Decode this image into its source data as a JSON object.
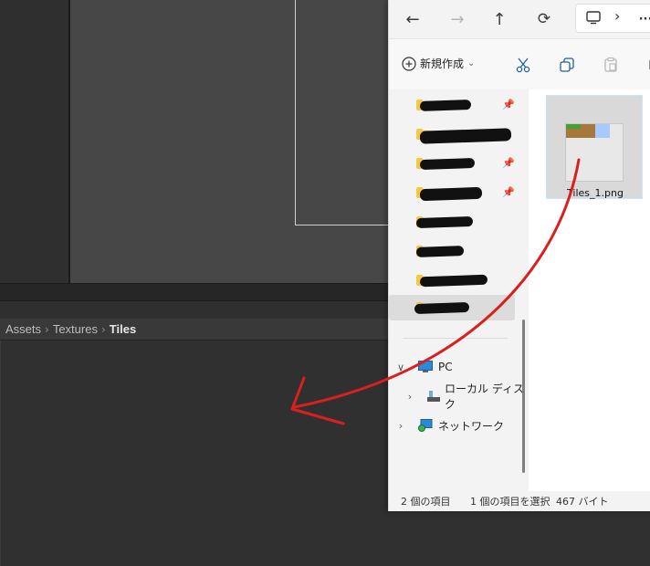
{
  "unity": {
    "breadcrumb": [
      "Assets",
      "Textures",
      "Tiles"
    ]
  },
  "explorer": {
    "nav": {
      "back_glyph": "←",
      "forward_glyph": "→",
      "up_glyph": "↑",
      "refresh_glyph": "⟳",
      "more_glyph": "···",
      "expand_glyph": "›"
    },
    "toolbar": {
      "new_label": "新規作成",
      "new_chevron": "⌄"
    },
    "tree": {
      "pc_label": "PC",
      "local_disk_label": "ローカル ディスク",
      "network_label": "ネットワーク"
    },
    "file": {
      "name": "Tiles_1.png"
    },
    "status": {
      "item_count": "2 個の項目",
      "selection": "1 個の項目を選択",
      "size": "467 バイト"
    }
  },
  "colors": {
    "annotation_red": "#d9201e",
    "selection_bg": "#dcdcdc",
    "folder_yellow": "#f6c744"
  },
  "icons": [
    "back-arrow-icon",
    "forward-arrow-icon",
    "up-arrow-icon",
    "refresh-icon",
    "view-icon",
    "chevron-right-icon",
    "more-icon",
    "new-plus-icon",
    "cut-icon",
    "copy-icon",
    "paste-icon",
    "folder-icon",
    "pin-icon",
    "pc-icon",
    "drive-icon",
    "network-icon",
    "drag-arrow-annotation"
  ]
}
